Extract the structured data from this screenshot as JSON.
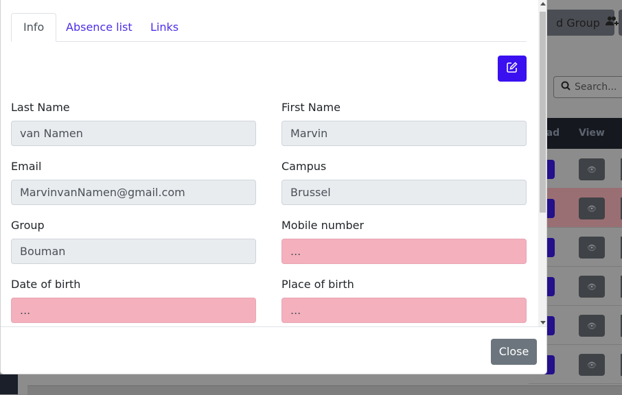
{
  "background": {
    "add_group_label": "d Group",
    "search_placeholder": "Search...",
    "table_headers": [
      "oad",
      "View"
    ]
  },
  "modal": {
    "tabs": [
      {
        "label": "Info",
        "active": true
      },
      {
        "label": "Absence list",
        "active": false
      },
      {
        "label": "Links",
        "active": false
      }
    ],
    "fields": {
      "last_name": {
        "label": "Last Name",
        "value": "van Namen"
      },
      "first_name": {
        "label": "First Name",
        "value": "Marvin"
      },
      "email": {
        "label": "Email",
        "value": "MarvinvanNamen@gmail.com"
      },
      "campus": {
        "label": "Campus",
        "value": "Brussel"
      },
      "group": {
        "label": "Group",
        "value": "Bouman"
      },
      "mobile": {
        "label": "Mobile number",
        "value": "..."
      },
      "dob": {
        "label": "Date of birth",
        "value": "..."
      },
      "pob": {
        "label": "Place of birth",
        "value": "..."
      }
    },
    "close_label": "Close"
  },
  "colors": {
    "primary": "#3a10f0",
    "missing_field": "#f4b0bd",
    "secondary": "#6c757d"
  },
  "icons": {
    "edit": "edit-icon",
    "search": "search-icon",
    "view": "eye-icon",
    "add_group": "users-plus-icon"
  }
}
